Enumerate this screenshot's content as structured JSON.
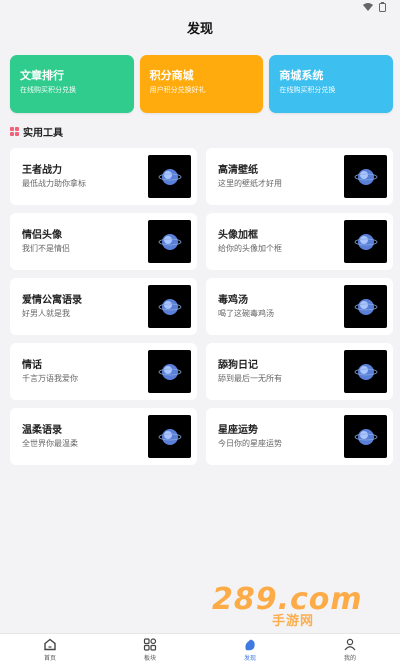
{
  "header": {
    "title": "发现"
  },
  "banners": [
    {
      "title": "文章排行",
      "subtitle": "在线购买积分兑换",
      "color": "#2fcc8d"
    },
    {
      "title": "积分商城",
      "subtitle": "用户积分兑换好礼",
      "color": "#ffab0d"
    },
    {
      "title": "商城系统",
      "subtitle": "在线购买积分兑换",
      "color": "#3dbff0"
    }
  ],
  "section": {
    "title": "实用工具"
  },
  "tools": [
    {
      "title": "王者战力",
      "subtitle": "最低战力助你拿标"
    },
    {
      "title": "高清壁纸",
      "subtitle": "这里的壁纸才好用"
    },
    {
      "title": "情侣头像",
      "subtitle": "我们不是情侣"
    },
    {
      "title": "头像加框",
      "subtitle": "给你的头像加个框"
    },
    {
      "title": "爱情公寓语录",
      "subtitle": "好男人就是我"
    },
    {
      "title": "毒鸡汤",
      "subtitle": "喝了这碗毒鸡汤"
    },
    {
      "title": "情话",
      "subtitle": "千言万语我爱你"
    },
    {
      "title": "舔狗日记",
      "subtitle": "舔到最后一无所有"
    },
    {
      "title": "温柔语录",
      "subtitle": "全世界你最温柔"
    },
    {
      "title": "星座运势",
      "subtitle": "今日你的星座运势"
    }
  ],
  "watermark": {
    "main": "289.com",
    "sub": "手游网"
  },
  "tabbar": [
    {
      "label": "首页",
      "icon": "home-icon"
    },
    {
      "label": "板块",
      "icon": "grid-icon"
    },
    {
      "label": "发现",
      "icon": "discover-icon",
      "active": true
    },
    {
      "label": "我的",
      "icon": "user-icon"
    }
  ]
}
